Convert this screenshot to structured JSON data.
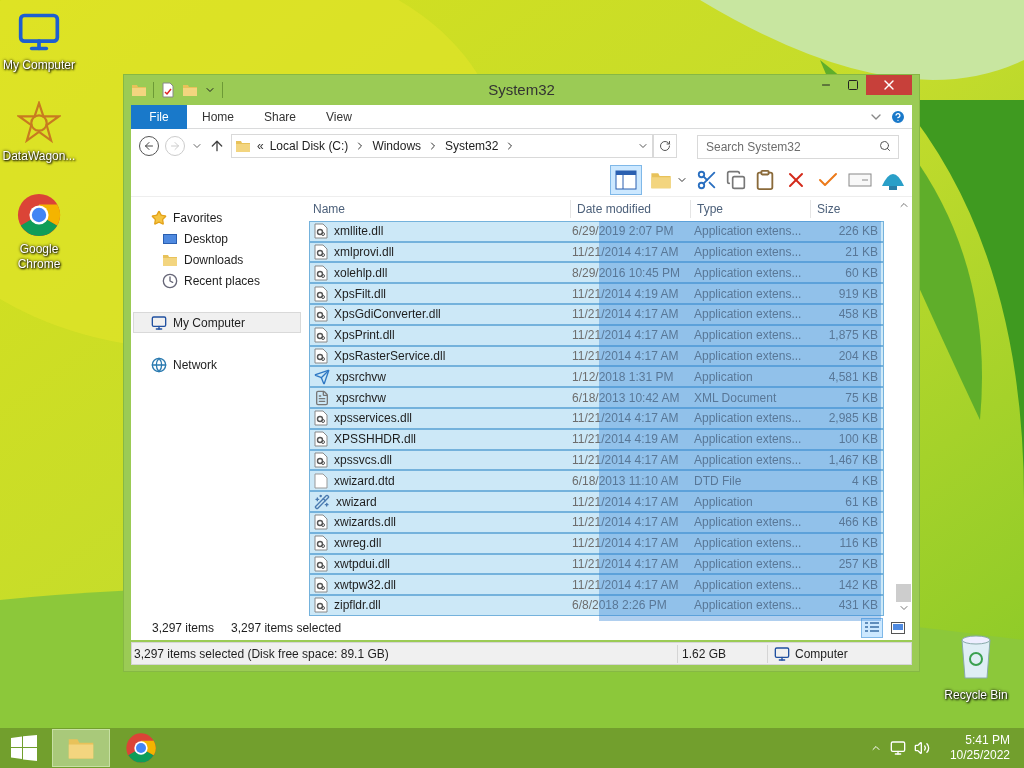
{
  "desktop_icons": [
    {
      "label": "My Computer",
      "kind": "computer"
    },
    {
      "label": "DataWagon...",
      "kind": "star"
    },
    {
      "label": "Google Chrome",
      "kind": "chrome"
    }
  ],
  "recycle_bin": {
    "label": "Recycle Bin"
  },
  "window": {
    "title": "System32",
    "ribbon_tabs": [
      {
        "label": "File",
        "kind": "file"
      },
      {
        "label": "Home",
        "kind": "tab"
      },
      {
        "label": "Share",
        "kind": "tab"
      },
      {
        "label": "View",
        "kind": "tab"
      }
    ],
    "address": {
      "overflow": "«",
      "crumbs": [
        "Local Disk (C:)",
        "Windows",
        "System32"
      ]
    },
    "search": {
      "placeholder": "Search System32"
    },
    "preview_pane_on": true,
    "nav": [
      {
        "label": "Favorites",
        "kind": "star",
        "selected": false,
        "children": [
          {
            "label": "Desktop",
            "kind": "desktop",
            "selected": false
          },
          {
            "label": "Downloads",
            "kind": "downloads",
            "selected": false
          },
          {
            "label": "Recent places",
            "kind": "recent",
            "selected": false
          }
        ]
      },
      {
        "label": "My Computer",
        "kind": "computer",
        "selected": true
      },
      {
        "label": "Network",
        "kind": "network",
        "selected": false
      }
    ],
    "columns": [
      "Name",
      "Date modified",
      "Type",
      "Size"
    ],
    "files": [
      {
        "name": "xmllite.dll",
        "date": "6/29/2019 2:07 PM",
        "type": "Application extens...",
        "size": "226 KB",
        "kind": "dll",
        "selected": true
      },
      {
        "name": "xmlprovi.dll",
        "date": "11/21/2014 4:17 AM",
        "type": "Application extens...",
        "size": "21 KB",
        "kind": "dll",
        "selected": true
      },
      {
        "name": "xolehlp.dll",
        "date": "8/29/2016 10:45 PM",
        "type": "Application extens...",
        "size": "60 KB",
        "kind": "dll",
        "selected": true
      },
      {
        "name": "XpsFilt.dll",
        "date": "11/21/2014 4:19 AM",
        "type": "Application extens...",
        "size": "919 KB",
        "kind": "dll",
        "selected": true
      },
      {
        "name": "XpsGdiConverter.dll",
        "date": "11/21/2014 4:17 AM",
        "type": "Application extens...",
        "size": "458 KB",
        "kind": "dll",
        "selected": true
      },
      {
        "name": "XpsPrint.dll",
        "date": "11/21/2014 4:17 AM",
        "type": "Application extens...",
        "size": "1,875 KB",
        "kind": "dll",
        "selected": true
      },
      {
        "name": "XpsRasterService.dll",
        "date": "11/21/2014 4:17 AM",
        "type": "Application extens...",
        "size": "204 KB",
        "kind": "dll",
        "selected": true
      },
      {
        "name": "xpsrchvw",
        "date": "1/12/2018 1:31 PM",
        "type": "Application",
        "size": "4,581 KB",
        "kind": "viewer",
        "selected": true
      },
      {
        "name": "xpsrchvw",
        "date": "6/18/2013 10:42 AM",
        "type": "XML Document",
        "size": "75 KB",
        "kind": "xml",
        "selected": true
      },
      {
        "name": "xpsservices.dll",
        "date": "11/21/2014 4:17 AM",
        "type": "Application extens...",
        "size": "2,985 KB",
        "kind": "dll",
        "selected": true
      },
      {
        "name": "XPSSHHDR.dll",
        "date": "11/21/2014 4:19 AM",
        "type": "Application extens...",
        "size": "100 KB",
        "kind": "dll",
        "selected": true
      },
      {
        "name": "xpssvcs.dll",
        "date": "11/21/2014 4:17 AM",
        "type": "Application extens...",
        "size": "1,467 KB",
        "kind": "dll",
        "selected": true
      },
      {
        "name": "xwizard.dtd",
        "date": "6/18/2013 11:10 AM",
        "type": "DTD File",
        "size": "4 KB",
        "kind": "blank",
        "selected": true
      },
      {
        "name": "xwizard",
        "date": "11/21/2014 4:17 AM",
        "type": "Application",
        "size": "61 KB",
        "kind": "wizard",
        "selected": true
      },
      {
        "name": "xwizards.dll",
        "date": "11/21/2014 4:17 AM",
        "type": "Application extens...",
        "size": "466 KB",
        "kind": "dll",
        "selected": true
      },
      {
        "name": "xwreg.dll",
        "date": "11/21/2014 4:17 AM",
        "type": "Application extens...",
        "size": "116 KB",
        "kind": "dll",
        "selected": true
      },
      {
        "name": "xwtpdui.dll",
        "date": "11/21/2014 4:17 AM",
        "type": "Application extens...",
        "size": "257 KB",
        "kind": "dll",
        "selected": true
      },
      {
        "name": "xwtpw32.dll",
        "date": "11/21/2014 4:17 AM",
        "type": "Application extens...",
        "size": "142 KB",
        "kind": "dll",
        "selected": true
      },
      {
        "name": "zipfldr.dll",
        "date": "6/8/2018 2:26 PM",
        "type": "Application extens...",
        "size": "431 KB",
        "kind": "dll",
        "selected": true
      }
    ],
    "selection_marquee": true,
    "item_count": "3,297 items",
    "selected_count": "3,297 items selected",
    "view_buttons": [
      {
        "kind": "details",
        "selected": true
      },
      {
        "kind": "thumbnails",
        "selected": false
      }
    ],
    "status": {
      "text": "3,297 items selected (Disk free space: 89.1 GB)",
      "size": "1.62 GB",
      "location": "Computer"
    }
  },
  "taskbar": {
    "items": [
      {
        "kind": "explorer",
        "active": true
      },
      {
        "kind": "chrome",
        "active": false
      }
    ],
    "time": "5:41 PM",
    "date": "10/25/2022"
  }
}
